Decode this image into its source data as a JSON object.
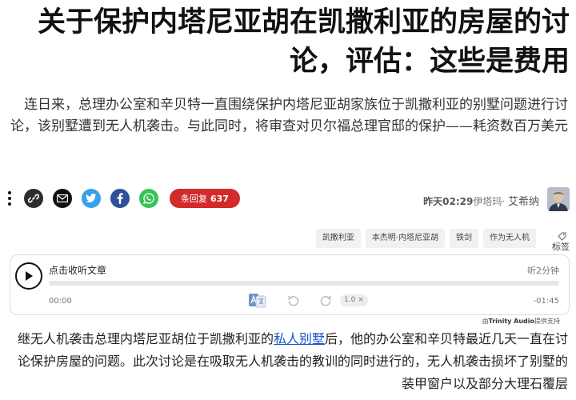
{
  "article": {
    "headline": "关于保护内塔尼亚胡在凯撒利亚的房屋的讨论，评估：这些是费用",
    "subtitle": "连日来，总理办公室和辛贝特一直围绕保护内塔尼亚胡家族位于凯撒利亚的别墅问题进行讨论，该别墅遭到无人机袭击。与此同时，将审查对贝尔福总理官邸的保护——耗资数百万美元"
  },
  "share": {
    "comments_label": "条回复",
    "comments_count": "637"
  },
  "byline": {
    "time": "昨天02:29",
    "place": "伊塔玛·",
    "author": "艾希纳"
  },
  "tags": {
    "items": [
      "凯撒利亚",
      "本杰明·内塔尼亚胡",
      "铁剑",
      "作为无人机"
    ],
    "label": "标签"
  },
  "player": {
    "title": "点击收听文章",
    "duration": "听2分钟",
    "time_start": "00:00",
    "time_end": "-01:45",
    "speed": "1.0",
    "progress": 0,
    "credit_prefix": "由",
    "credit_brand": "Trinity Audio",
    "credit_suffix": "提供支持"
  },
  "body": {
    "para_before_link": "继无人机袭击总理内塔尼亚胡位于凯撒利亚的",
    "link_text": "私人别墅",
    "para_after_link": "后，他的办公室和辛贝特最近几天一直在讨论保护房屋的问题。此次讨论是在吸取无人机袭击的教训的同时进行的，无人机袭击损坏了别墅的装甲窗户以及部分大理石覆层"
  },
  "colors": {
    "comments_red": "#d32a2a",
    "twitter_blue": "#3aa0e8",
    "facebook_blue": "#2f4f9a",
    "whatsapp_green": "#36c456",
    "link_blue": "#1a55c9"
  }
}
